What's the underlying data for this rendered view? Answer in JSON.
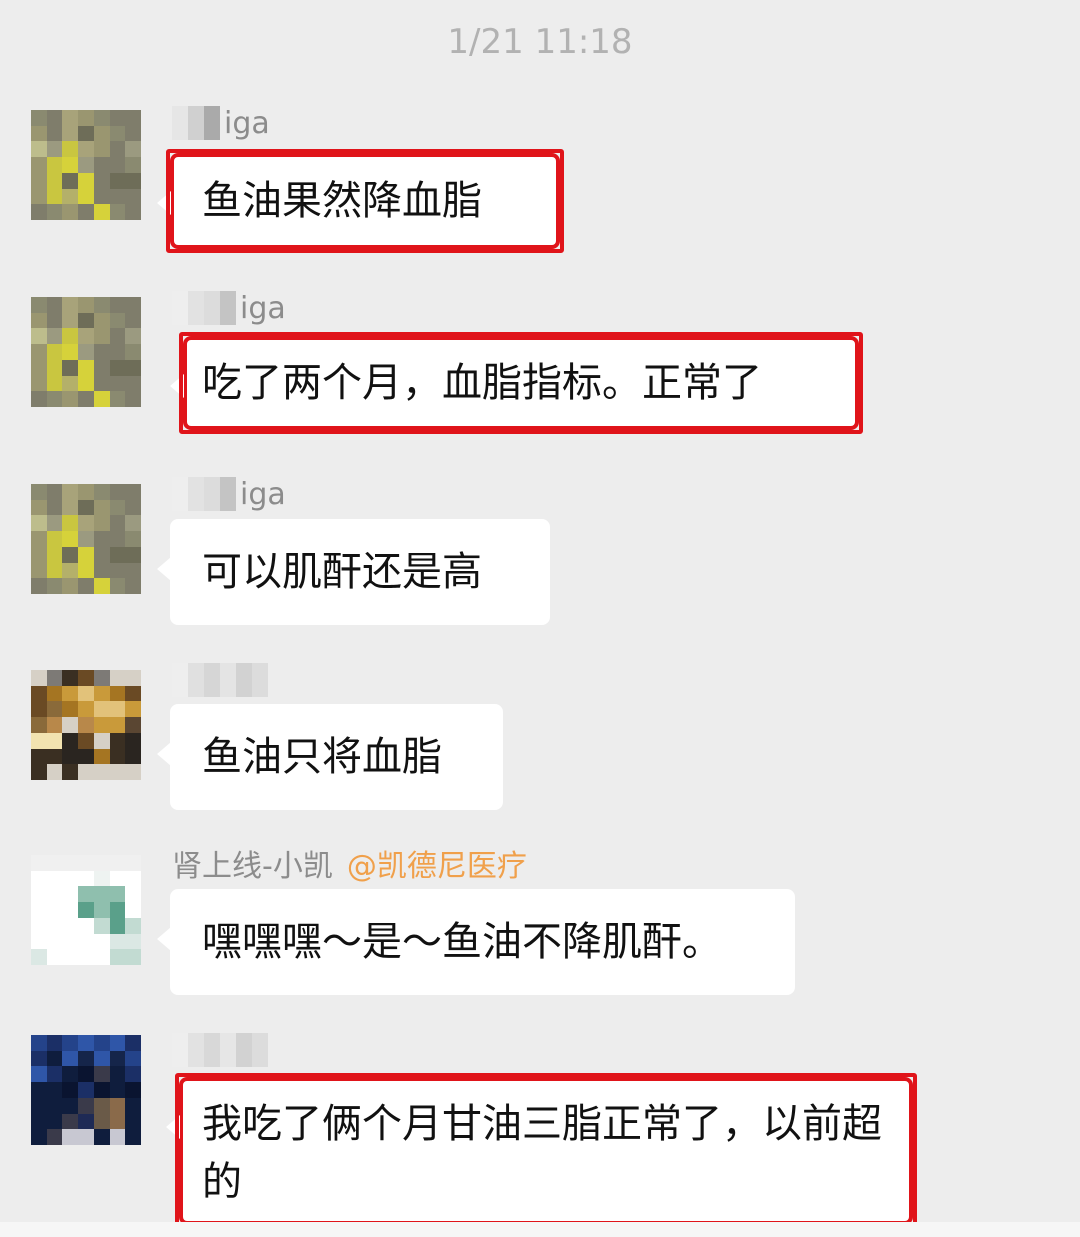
{
  "timestamp": "1/21 11:18",
  "messages": [
    {
      "sender": "iga",
      "sender_tag": "",
      "text": "鱼油果然降血脂",
      "highlighted": true
    },
    {
      "sender": "iga",
      "sender_tag": "",
      "text": "吃了两个月，血脂指标。正常了",
      "highlighted": true
    },
    {
      "sender": "iga",
      "sender_tag": "",
      "text": "可以肌酐还是高",
      "highlighted": false
    },
    {
      "sender": "",
      "sender_tag": "",
      "text": "鱼油只将血脂",
      "highlighted": false
    },
    {
      "sender": "肾上线-小凯",
      "sender_tag": "@凯德尼医疗",
      "text": "嘿嘿嘿～是～鱼油不降肌酐。",
      "highlighted": false
    },
    {
      "sender": "",
      "sender_tag": "",
      "text": "我吃了俩个月甘油三脂正常了，以前超的",
      "highlighted": true
    }
  ],
  "colors": {
    "background": "#ededed",
    "bubble": "#ffffff",
    "highlight": "#e0141a",
    "mention": "#f0a04b"
  },
  "icons": [
    "blurred-avatar-icon"
  ]
}
